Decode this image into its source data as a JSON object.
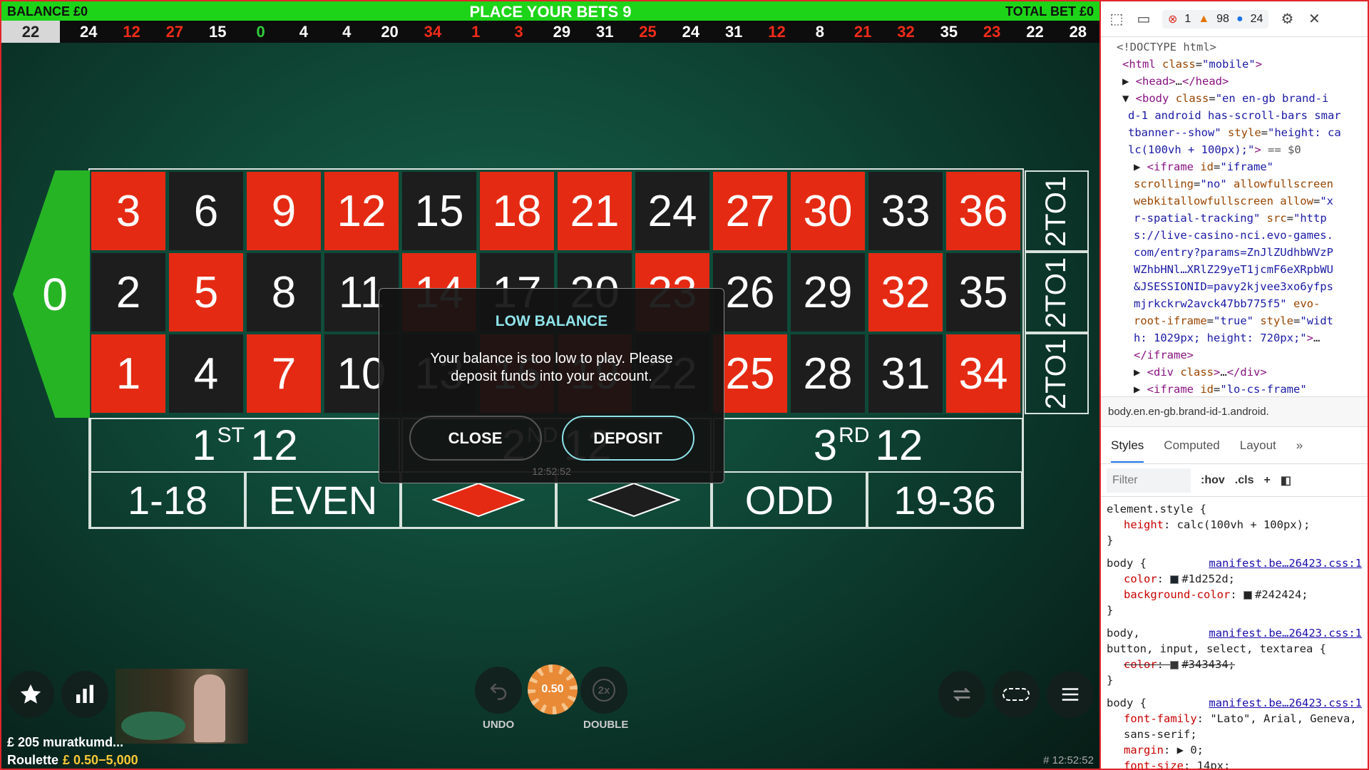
{
  "game": {
    "balance_label": "BALANCE £0",
    "title": "PLACE YOUR BETS 9",
    "total_bet_label": "TOTAL BET £0",
    "history": [
      {
        "n": "22",
        "c": "black"
      },
      {
        "n": "24",
        "c": "black"
      },
      {
        "n": "12",
        "c": "red"
      },
      {
        "n": "27",
        "c": "red"
      },
      {
        "n": "15",
        "c": "black"
      },
      {
        "n": "0",
        "c": "green"
      },
      {
        "n": "4",
        "c": "black"
      },
      {
        "n": "4",
        "c": "black"
      },
      {
        "n": "20",
        "c": "black"
      },
      {
        "n": "34",
        "c": "red"
      },
      {
        "n": "1",
        "c": "red"
      },
      {
        "n": "3",
        "c": "red"
      },
      {
        "n": "29",
        "c": "black"
      },
      {
        "n": "31",
        "c": "black"
      },
      {
        "n": "25",
        "c": "red"
      },
      {
        "n": "24",
        "c": "black"
      },
      {
        "n": "31",
        "c": "black"
      },
      {
        "n": "12",
        "c": "red"
      },
      {
        "n": "8",
        "c": "black"
      },
      {
        "n": "21",
        "c": "red"
      },
      {
        "n": "32",
        "c": "red"
      },
      {
        "n": "35",
        "c": "black"
      },
      {
        "n": "23",
        "c": "red"
      },
      {
        "n": "22",
        "c": "black"
      },
      {
        "n": "28",
        "c": "black"
      }
    ],
    "zero": "0",
    "rows": [
      [
        {
          "n": "3",
          "c": "red"
        },
        {
          "n": "6",
          "c": "black"
        },
        {
          "n": "9",
          "c": "red"
        },
        {
          "n": "12",
          "c": "red"
        },
        {
          "n": "15",
          "c": "black"
        },
        {
          "n": "18",
          "c": "red"
        },
        {
          "n": "21",
          "c": "red"
        },
        {
          "n": "24",
          "c": "black"
        },
        {
          "n": "27",
          "c": "red"
        },
        {
          "n": "30",
          "c": "red"
        },
        {
          "n": "33",
          "c": "black"
        },
        {
          "n": "36",
          "c": "red"
        }
      ],
      [
        {
          "n": "2",
          "c": "black"
        },
        {
          "n": "5",
          "c": "red"
        },
        {
          "n": "8",
          "c": "black"
        },
        {
          "n": "11",
          "c": "black"
        },
        {
          "n": "14",
          "c": "red"
        },
        {
          "n": "17",
          "c": "black"
        },
        {
          "n": "20",
          "c": "black"
        },
        {
          "n": "23",
          "c": "red"
        },
        {
          "n": "26",
          "c": "black"
        },
        {
          "n": "29",
          "c": "black"
        },
        {
          "n": "32",
          "c": "red"
        },
        {
          "n": "35",
          "c": "black"
        }
      ],
      [
        {
          "n": "1",
          "c": "red"
        },
        {
          "n": "4",
          "c": "black"
        },
        {
          "n": "7",
          "c": "red"
        },
        {
          "n": "10",
          "c": "black"
        },
        {
          "n": "13",
          "c": "black"
        },
        {
          "n": "16",
          "c": "red"
        },
        {
          "n": "19",
          "c": "red"
        },
        {
          "n": "22",
          "c": "black"
        },
        {
          "n": "25",
          "c": "red"
        },
        {
          "n": "28",
          "c": "black"
        },
        {
          "n": "31",
          "c": "black"
        },
        {
          "n": "34",
          "c": "red"
        }
      ]
    ],
    "column_bet": "2TO1",
    "dozens": [
      {
        "num": "1",
        "sup": "ST",
        "rest": "12"
      },
      {
        "num": "2",
        "sup": "ND",
        "rest": "12"
      },
      {
        "num": "3",
        "sup": "RD",
        "rest": "12"
      }
    ],
    "outside": [
      "1-18",
      "EVEN",
      "",
      "",
      "ODD",
      "19-36"
    ],
    "modal": {
      "title": "LOW BALANCE",
      "message": "Your balance is too low to play. Please deposit funds into your account.",
      "close": "CLOSE",
      "deposit": "DEPOSIT",
      "time": "12:52:52"
    },
    "chip_value": "0.50",
    "undo_label": "UNDO",
    "double_label": "DOUBLE",
    "double_icon": "2x",
    "user_line": "£ 205 muratkumd...",
    "game_name": "Roulette",
    "limits": "£ 0.50−5,000",
    "clock": "# 12:52:52",
    "colors": {
      "red": "#e52a13",
      "black": "#1d1d1d",
      "green": "#26b425",
      "accent": "#8fe3ea"
    }
  },
  "devtools": {
    "errors": "1",
    "warnings": "98",
    "messages": "24",
    "dom_lines": [
      {
        "indent": 0,
        "html": "<span class='muted'>&lt;!DOCTYPE html&gt;</span>"
      },
      {
        "indent": 1,
        "html": "<span class='tag'>&lt;html</span> <span class='attr'>class</span>=<span class='val'>\"mobile\"</span><span class='tag'>&gt;</span>"
      },
      {
        "indent": 1,
        "html": "▶ <span class='tag'>&lt;head&gt;</span>…<span class='tag'>&lt;/head&gt;</span>"
      },
      {
        "indent": 1,
        "html": "▼ <span class='tag'>&lt;body</span> <span class='attr'>class</span>=<span class='val'>\"en en-gb brand-i</span>"
      },
      {
        "indent": 2,
        "html": "<span class='val'>d-1 android has-scroll-bars smar</span>"
      },
      {
        "indent": 2,
        "html": "<span class='val'>tbanner--show\"</span> <span class='attr'>style</span>=<span class='val'>\"height: ca</span>"
      },
      {
        "indent": 2,
        "html": "<span class='val'>lc(100vh + 100px);\"</span><span class='tag'>&gt;</span> <span class='muted'>== $0</span>"
      },
      {
        "indent": 3,
        "html": "▶ <span class='tag'>&lt;iframe</span> <span class='attr'>id</span>=<span class='val'>\"iframe\"</span>"
      },
      {
        "indent": 3,
        "html": "<span class='attr'>scrolling</span>=<span class='val'>\"no\"</span> <span class='attr'>allowfullscreen</span>"
      },
      {
        "indent": 3,
        "html": "<span class='attr'>webkitallowfullscreen allow</span>=<span class='val'>\"x</span>"
      },
      {
        "indent": 3,
        "html": "<span class='val'>r-spatial-tracking\"</span> <span class='attr'>src</span>=<span class='val'>\"http</span>"
      },
      {
        "indent": 3,
        "html": "<span class='val'>s://live-casino-nci.evo-games.</span>"
      },
      {
        "indent": 3,
        "html": "<span class='val'>com/entry?params=ZnJlZUdhbWVzP</span>"
      },
      {
        "indent": 3,
        "html": "<span class='val'>WZhbHNl…XRlZ29yeT1jcmF6eXRpbWU</span>"
      },
      {
        "indent": 3,
        "html": "<span class='val'>&amp;JSESSIONID=pavy2kjvee3xo6yfps</span>"
      },
      {
        "indent": 3,
        "html": "<span class='val'>mjrkckrw2avck47bb775f5\"</span> <span class='attr'>evo-</span>"
      },
      {
        "indent": 3,
        "html": "<span class='attr'>root-iframe</span>=<span class='val'>\"true\"</span> <span class='attr'>style</span>=<span class='val'>\"widt</span>"
      },
      {
        "indent": 3,
        "html": "<span class='val'>h: 1029px; height: 720px;\"</span><span class='tag'>&gt;</span>…"
      },
      {
        "indent": 3,
        "html": "<span class='tag'>&lt;/iframe&gt;</span>"
      },
      {
        "indent": 3,
        "html": "▶ <span class='tag'>&lt;div</span> <span class='attr'>class</span><span class='tag'>&gt;</span>…<span class='tag'>&lt;/div&gt;</span>"
      },
      {
        "indent": 3,
        "html": "▶ <span class='tag'>&lt;iframe</span> <span class='attr'>id</span>=<span class='val'>\"lo-cs-frame\"</span>"
      }
    ],
    "breadcrumb": "body.en.en-gb.brand-id-1.android.",
    "tabs": [
      "Styles",
      "Computed",
      "Layout"
    ],
    "filter_placeholder": "Filter",
    "hov": ":hov",
    "cls": ".cls",
    "rules": [
      {
        "sel": "element.style {",
        "src": "",
        "props": [
          {
            "n": "height",
            "v": "calc(100vh + 100px);"
          }
        ]
      },
      {
        "sel": "body {",
        "src": "manifest.be…26423.css:1",
        "props": [
          {
            "n": "color",
            "v": "#1d252d;",
            "sw": "#1d252d"
          },
          {
            "n": "background-color",
            "v": "#242424;",
            "sw": "#242424"
          }
        ]
      },
      {
        "sel": "body,",
        "src": "manifest.be…26423.css:1",
        "sel2": "button, input, select, textarea {",
        "props": [
          {
            "n": "color",
            "v": "#343434;",
            "sw": "#343434",
            "strike": true
          }
        ]
      },
      {
        "sel": "body {",
        "src": "manifest.be…26423.css:1",
        "props": [
          {
            "n": "font-family",
            "v": "\"Lato\", Arial, Geneva, sans-serif;"
          },
          {
            "n": "margin",
            "v": "▶ 0;"
          },
          {
            "n": "font-size",
            "v": "14px;"
          }
        ]
      }
    ]
  }
}
